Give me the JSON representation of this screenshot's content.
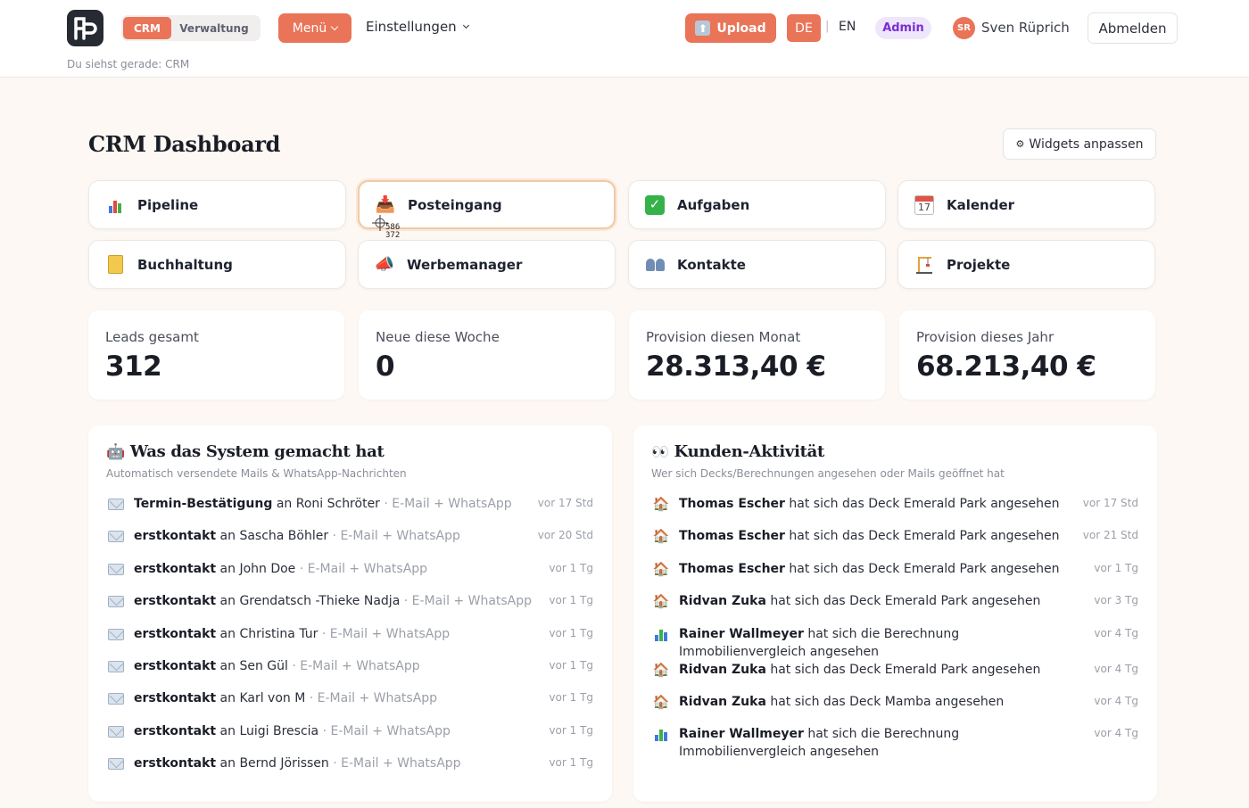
{
  "header": {
    "mode_active": "CRM",
    "mode_inactive": "Verwaltung",
    "menu_label": "Menü",
    "settings_label": "Einstellungen",
    "upload_label": "Upload",
    "lang_de": "DE",
    "lang_sep": "|",
    "lang_en": "EN",
    "admin_badge": "Admin",
    "avatar_initials": "SR",
    "user_name": "Sven Rüprich",
    "logout_label": "Abmelden",
    "view_hint": "Du siehst gerade: CRM",
    "accent_color": "#e97458"
  },
  "page": {
    "title": "CRM Dashboard",
    "widgets_button": "Widgets anpassen"
  },
  "tiles": [
    {
      "label": "Pipeline",
      "icon": "bar-chart-icon"
    },
    {
      "label": "Posteingang",
      "icon": "inbox-tray-icon"
    },
    {
      "label": "Aufgaben",
      "icon": "check-mark-icon"
    },
    {
      "label": "Kalender",
      "icon": "calendar-icon"
    },
    {
      "label": "Buchhaltung",
      "icon": "ledger-icon"
    },
    {
      "label": "Werbemanager",
      "icon": "megaphone-icon"
    },
    {
      "label": "Kontakte",
      "icon": "people-icon"
    },
    {
      "label": "Projekte",
      "icon": "construction-crane-icon"
    }
  ],
  "cursor_readout": {
    "x": "586",
    "y": "372"
  },
  "stats": [
    {
      "label": "Leads gesamt",
      "value": "312"
    },
    {
      "label": "Neue diese Woche",
      "value": "0"
    },
    {
      "label": "Provision diesen Monat",
      "value": "28.313,40 €"
    },
    {
      "label": "Provision dieses Jahr",
      "value": "68.213,40 €"
    }
  ],
  "system_panel": {
    "title": "Was das System gemacht hat",
    "subtitle": "Automatisch versendete Mails & WhatsApp-Nachrichten",
    "items": [
      {
        "bold": "Termin-Bestätigung",
        "text": " an Roni Schröter",
        "channel": " · E-Mail + WhatsApp",
        "time": "vor 17 Std"
      },
      {
        "bold": "erstkontakt",
        "text": " an Sascha Böhler",
        "channel": " · E-Mail + WhatsApp",
        "time": "vor 20 Std"
      },
      {
        "bold": "erstkontakt",
        "text": " an John Doe",
        "channel": " · E-Mail + WhatsApp",
        "time": "vor 1 Tg"
      },
      {
        "bold": "erstkontakt",
        "text": " an Grendatsch -Thieke Nadja",
        "channel": " · E-Mail + WhatsApp",
        "time": "vor 1 Tg"
      },
      {
        "bold": "erstkontakt",
        "text": " an Christina Tur",
        "channel": " · E-Mail + WhatsApp",
        "time": "vor 1 Tg"
      },
      {
        "bold": "erstkontakt",
        "text": " an Sen Gül",
        "channel": " · E-Mail + WhatsApp",
        "time": "vor 1 Tg"
      },
      {
        "bold": "erstkontakt",
        "text": " an Karl von M",
        "channel": " · E-Mail + WhatsApp",
        "time": "vor 1 Tg"
      },
      {
        "bold": "erstkontakt",
        "text": " an Luigi Brescia",
        "channel": " · E-Mail + WhatsApp",
        "time": "vor 1 Tg"
      },
      {
        "bold": "erstkontakt",
        "text": " an Bernd Jörissen",
        "channel": " · E-Mail + WhatsApp",
        "time": "vor 1 Tg"
      }
    ]
  },
  "activity_panel": {
    "title": "Kunden-Aktivität",
    "subtitle": "Wer sich Decks/Berechnungen angesehen oder Mails geöffnet hat",
    "items": [
      {
        "icon": "house",
        "bold": "Thomas Escher",
        "text": " hat sich das Deck Emerald Park angesehen",
        "time": "vor 17 Std"
      },
      {
        "icon": "house",
        "bold": "Thomas Escher",
        "text": " hat sich das Deck Emerald Park angesehen",
        "time": "vor 21 Std"
      },
      {
        "icon": "house",
        "bold": "Thomas Escher",
        "text": " hat sich das Deck Emerald Park angesehen",
        "time": "vor 1 Tg"
      },
      {
        "icon": "house",
        "bold": "Ridvan Zuka",
        "text": " hat sich das Deck Emerald Park angesehen",
        "time": "vor 3 Tg"
      },
      {
        "icon": "chart",
        "bold": "Rainer Wallmeyer",
        "text": " hat sich die Berechnung Immobilienvergleich angesehen",
        "time": "vor 4 Tg"
      },
      {
        "icon": "house",
        "bold": "Ridvan Zuka",
        "text": " hat sich das Deck Emerald Park angesehen",
        "time": "vor 4 Tg"
      },
      {
        "icon": "house",
        "bold": "Ridvan Zuka",
        "text": " hat sich das Deck Mamba angesehen",
        "time": "vor 4 Tg"
      },
      {
        "icon": "chart",
        "bold": "Rainer Wallmeyer",
        "text": " hat sich die Berechnung Immobilienvergleich angesehen",
        "time": "vor 4 Tg"
      }
    ]
  }
}
